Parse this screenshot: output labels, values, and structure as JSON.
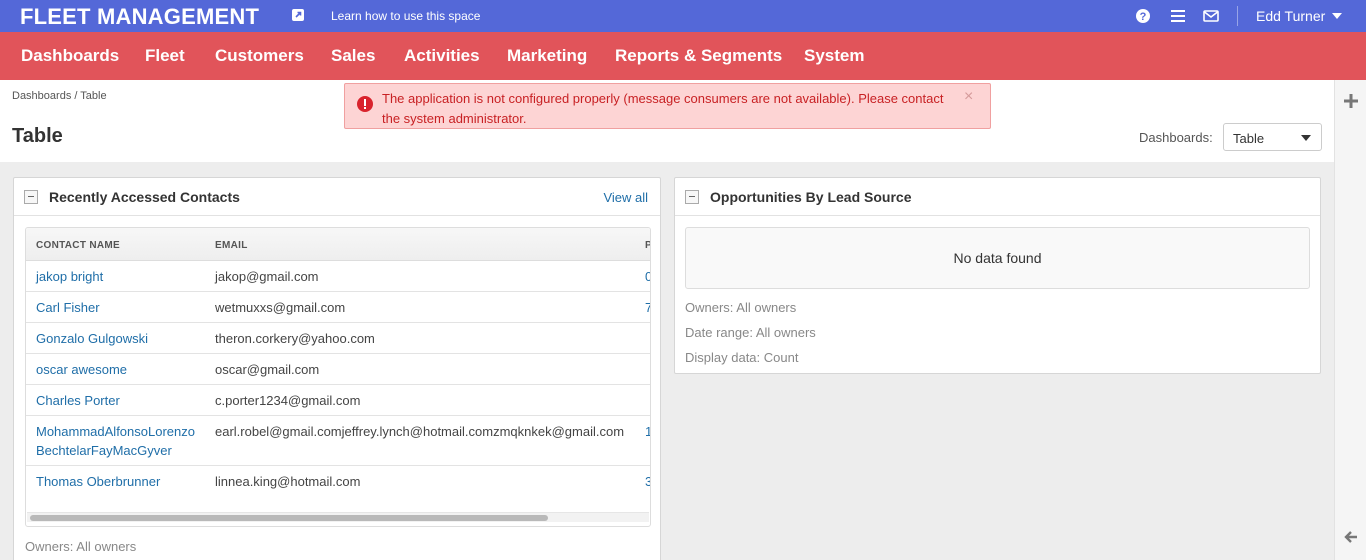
{
  "topbar": {
    "brand": "FLEET MANAGEMENT",
    "learn_link": "Learn how to use this space",
    "user_name": "Edd Turner",
    "icons": [
      "external-link-icon",
      "help-icon",
      "list-icon",
      "mail-icon",
      "caret-down-icon"
    ]
  },
  "menu": {
    "items": [
      "Dashboards",
      "Fleet",
      "Customers",
      "Sales",
      "Activities",
      "Marketing",
      "Reports & Segments",
      "System"
    ]
  },
  "breadcrumb": "Dashboards / Table",
  "page_title": "Table",
  "dashboard_selector": {
    "label": "Dashboards:",
    "value": "Table"
  },
  "alert": {
    "text": "The application is not configured properly (message consumers are not available). Please contact the system administrator.",
    "close": "×"
  },
  "recent_contacts": {
    "title": "Recently Accessed Contacts",
    "view_all": "View all",
    "columns": [
      "CONTACT NAME",
      "EMAIL",
      "P"
    ],
    "rows": [
      {
        "name": "jakop bright",
        "email": "jakop@gmail.com",
        "phone": "0"
      },
      {
        "name": "Carl Fisher",
        "email": "wetmuxxs@gmail.com",
        "phone": "7"
      },
      {
        "name": "Gonzalo Gulgowski",
        "email": "theron.corkery@yahoo.com",
        "phone": ""
      },
      {
        "name": "oscar awesome",
        "email": "oscar@gmail.com",
        "phone": ""
      },
      {
        "name": "Charles Porter",
        "email": "c.porter1234@gmail.com",
        "phone": ""
      },
      {
        "name": "MohammadAlfonsoLorenzo BechtelarFayMacGyver",
        "email": "earl.robel@gmail.comjeffrey.lynch@hotmail.comzmqknkek@gmail.com",
        "phone": "1"
      },
      {
        "name": "Thomas Oberbrunner",
        "email": "linnea.king@hotmail.com",
        "phone": "3"
      }
    ],
    "footer": "Owners: All owners"
  },
  "opportunities": {
    "title": "Opportunities By Lead Source",
    "no_data": "No data found",
    "owners": "Owners: All owners",
    "date_range": "Date range: All owners",
    "display": "Display data: Count"
  },
  "colors": {
    "topbar": "#5468d8",
    "menubar": "#e1545a",
    "link": "#1f6ea8",
    "alert_bg": "#fdd4d4",
    "alert_text": "#c82124"
  }
}
